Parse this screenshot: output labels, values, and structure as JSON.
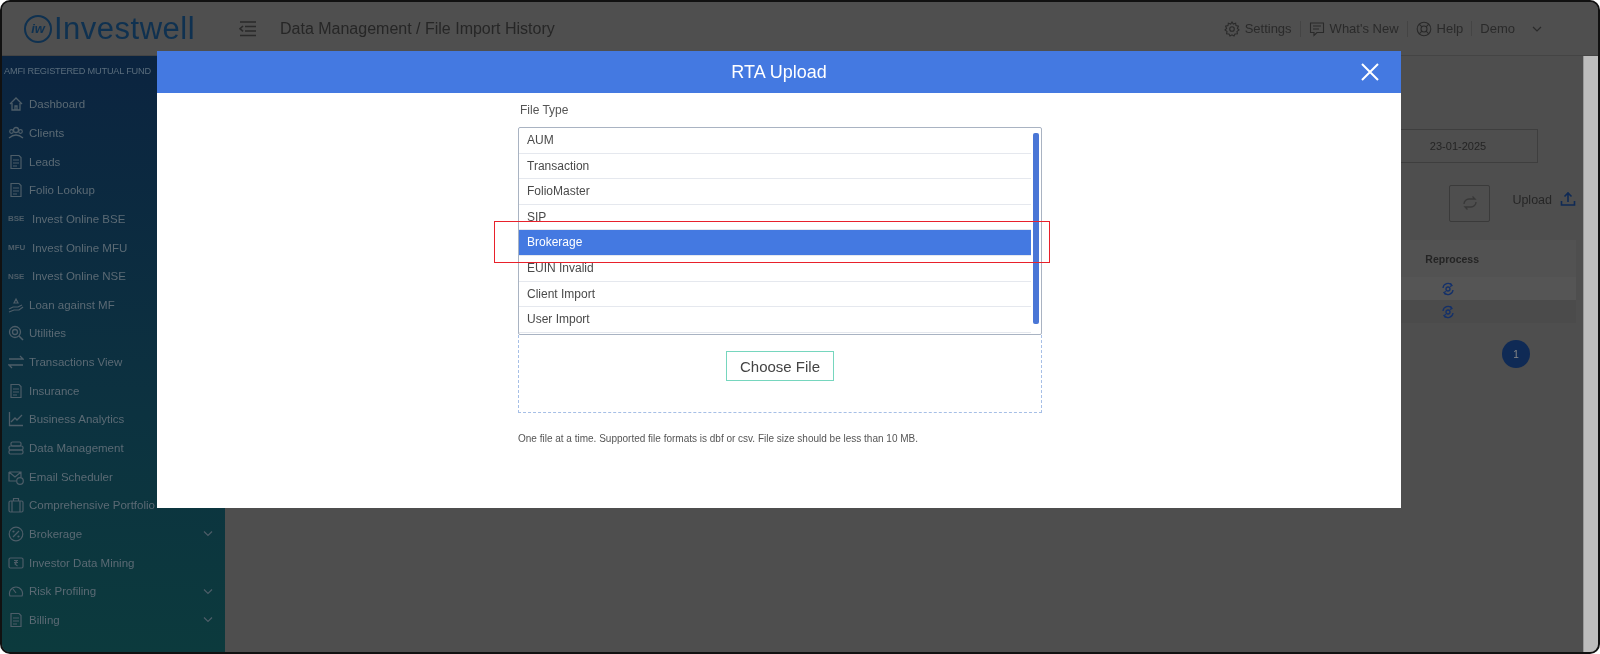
{
  "header": {
    "logo_mark": "iw",
    "logo_text": "Investwell",
    "breadcrumb": "Data Management / File Import History",
    "nav": [
      {
        "kind": "settings",
        "label": "Settings"
      },
      {
        "kind": "news",
        "label": "What's New"
      },
      {
        "kind": "help",
        "label": "Help"
      },
      {
        "kind": "user",
        "label": "Demo"
      }
    ]
  },
  "sidebar": {
    "heading": "AMFI REGISTERED MUTUAL FUND",
    "items": [
      {
        "kind": "home",
        "label": "Dashboard"
      },
      {
        "kind": "people",
        "label": "Clients"
      },
      {
        "kind": "doc",
        "label": "Leads"
      },
      {
        "kind": "doc",
        "label": "Folio Lookup"
      },
      {
        "kind": "badge",
        "badge": "BSE",
        "label": "Invest Online BSE"
      },
      {
        "kind": "badge",
        "badge": "MFU",
        "label": "Invest Online MFU"
      },
      {
        "kind": "badge",
        "badge": "NSE",
        "label": "Invest Online NSE"
      },
      {
        "kind": "hand",
        "label": "Loan against MF"
      },
      {
        "kind": "target",
        "label": "Utilities"
      },
      {
        "kind": "arrows",
        "label": "Transactions View"
      },
      {
        "kind": "doc",
        "label": "Insurance"
      },
      {
        "kind": "chart",
        "label": "Business Analytics"
      },
      {
        "kind": "stack",
        "label": "Data Management"
      },
      {
        "kind": "mail",
        "label": "Email Scheduler"
      },
      {
        "kind": "case",
        "label": "Comprehensive Portfolio"
      },
      {
        "kind": "percent",
        "label": "Brokerage",
        "expandable": true
      },
      {
        "kind": "rupee",
        "label": "Investor Data Mining",
        "expandable": false
      },
      {
        "kind": "gauge",
        "label": "Risk Profiling",
        "expandable": true
      },
      {
        "kind": "doc",
        "label": "Billing",
        "expandable": true
      }
    ]
  },
  "content": {
    "date": "23-01-2025",
    "upload": "Upload",
    "table": {
      "columns": [
        "Reprocess"
      ],
      "rows": [
        {
          "kind": "reprocess"
        },
        {
          "kind": "reprocess"
        }
      ]
    },
    "pagination": [
      {
        "label": "1",
        "selected": true
      }
    ]
  },
  "modal": {
    "title": "RTA Upload",
    "field_label": "File Type",
    "options": [
      {
        "label": "AUM",
        "selected": false,
        "highlighted": false
      },
      {
        "label": "Transaction",
        "selected": false,
        "highlighted": false
      },
      {
        "label": "FolioMaster",
        "selected": false,
        "highlighted": false
      },
      {
        "label": "SIP",
        "selected": false,
        "highlighted": false
      },
      {
        "label": "Brokerage",
        "selected": true,
        "highlighted": true
      },
      {
        "label": "EUIN Invalid",
        "selected": false,
        "highlighted": false
      },
      {
        "label": "Client Import",
        "selected": false,
        "highlighted": false
      },
      {
        "label": "User Import",
        "selected": false,
        "highlighted": false
      }
    ],
    "button": "Choose File",
    "note": "One file at a time. Supported file formats is dbf or csv. File size should be less than 10 MB."
  }
}
